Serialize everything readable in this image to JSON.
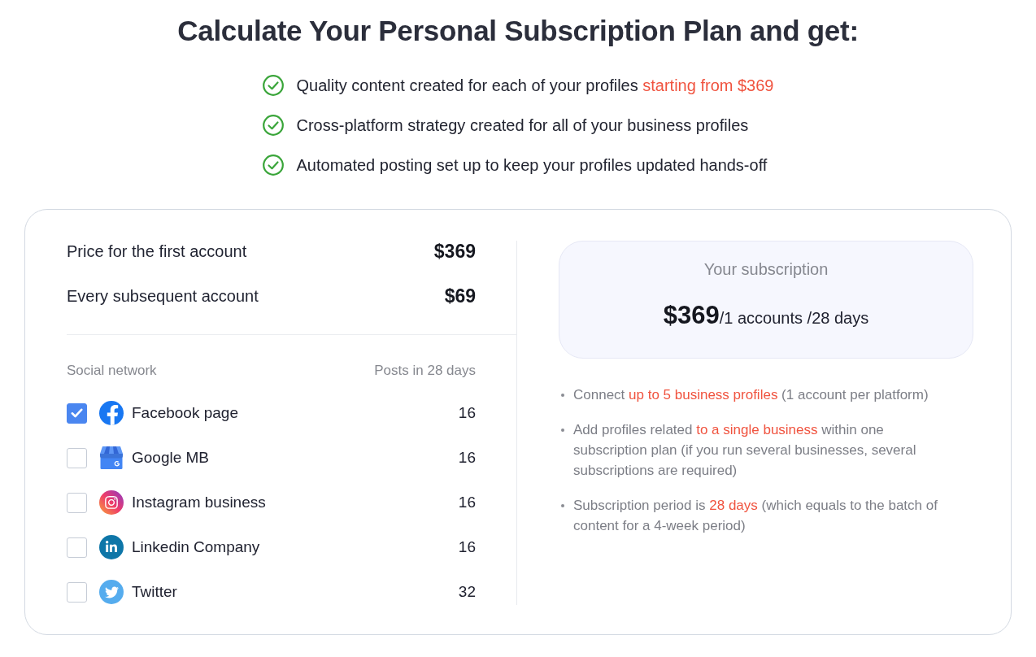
{
  "heading": "Calculate Your Personal Subscription Plan and get:",
  "benefits": [
    {
      "segments": [
        {
          "text": "Quality content created for each of your profiles ",
          "accent": false
        },
        {
          "text": "starting from $369",
          "accent": true
        }
      ]
    },
    {
      "segments": [
        {
          "text": "Cross-platform strategy created for all of your business profiles",
          "accent": false
        }
      ]
    },
    {
      "segments": [
        {
          "text": "Automated posting set up to keep your profiles updated hands-off",
          "accent": false
        }
      ]
    }
  ],
  "pricing": [
    {
      "label": "Price for the first account",
      "price": "$369"
    },
    {
      "label": "Every subsequent account",
      "price": "$69"
    }
  ],
  "network_table": {
    "columns": [
      "Social network",
      "Posts in 28 days"
    ],
    "rows": [
      {
        "kind": "facebook",
        "name": "Facebook page",
        "posts": "16",
        "checked": true
      },
      {
        "kind": "google",
        "name": "Google MB",
        "posts": "16",
        "checked": false
      },
      {
        "kind": "instagram",
        "name": "Instagram business",
        "posts": "16",
        "checked": false
      },
      {
        "kind": "linkedin",
        "name": "Linkedin Company",
        "posts": "16",
        "checked": false
      },
      {
        "kind": "twitter",
        "name": "Twitter",
        "posts": "32",
        "checked": false
      }
    ]
  },
  "subscription": {
    "title": "Your subscription",
    "price": "$369",
    "terms": "/1 accounts /28 days"
  },
  "notes": [
    {
      "segments": [
        {
          "text": "Connect ",
          "accent": false
        },
        {
          "text": "up to 5 business profiles",
          "accent": true
        },
        {
          "text": " (1 account per platform)",
          "accent": false
        }
      ]
    },
    {
      "segments": [
        {
          "text": "Add profiles related ",
          "accent": false
        },
        {
          "text": "to a single business",
          "accent": true
        },
        {
          "text": " within one subscription plan (if you run several businesses, several subscriptions are required)",
          "accent": false
        }
      ]
    },
    {
      "segments": [
        {
          "text": "Subscription period is ",
          "accent": false
        },
        {
          "text": "28 days",
          "accent": true
        },
        {
          "text": " (which equals to the batch of content for a 4-week period)",
          "accent": false
        }
      ]
    }
  ]
}
